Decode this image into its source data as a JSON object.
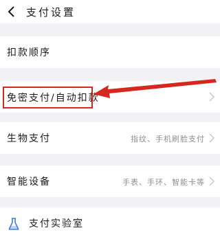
{
  "header": {
    "title": "支付设置",
    "back_icon": "chevron-left-icon"
  },
  "rows": [
    {
      "label": "扣款顺序",
      "value": ""
    },
    {
      "label": "免密支付/自动扣款",
      "value": ""
    },
    {
      "label": "生物支付",
      "value": "指纹、手机刷脸支付"
    },
    {
      "label": "智能设备",
      "value": "手表、手环、智能卡等"
    },
    {
      "label": "支付实验室",
      "value": "",
      "icon": "flask-icon"
    }
  ],
  "annotation": {
    "color": "#d6281e",
    "type": "arrow-and-box"
  },
  "colors": {
    "background": "#f2f2f4",
    "row": "#ffffff",
    "secondary_text": "#8e8e93",
    "chevron": "#c7c7cc"
  }
}
